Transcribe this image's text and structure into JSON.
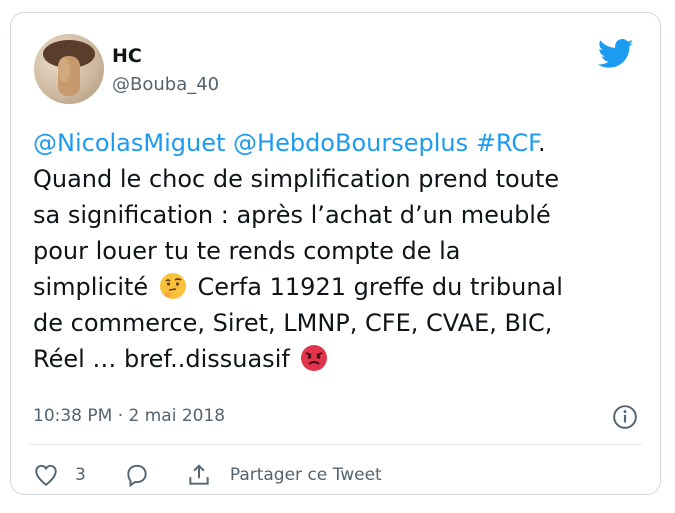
{
  "tweet": {
    "author_name": "HC",
    "author_handle": "@Bouba_40",
    "mentions": [
      "@NicolasMiguet",
      "@HebdoBourseplus",
      "#RCF"
    ],
    "text_after_mentions": ".",
    "line2": "Quand le choc de simplification prend toute",
    "line3": "sa signification : après l’achat d’un meublé",
    "line4": "pour louer tu te rends compte de la",
    "line5a": "simplicité",
    "line5b": "Cerfa 11921 greffe du tribunal",
    "line6": "de commerce, Siret, LMNP, CFE, CVAE, BIC,",
    "line7": "Réel … bref..dissuasif",
    "timestamp": "10:38 PM · 2 mai 2018",
    "like_count": "3",
    "share_label": "Partager ce Tweet"
  },
  "icons": {
    "brand": "twitter-bird-icon",
    "info": "info-icon",
    "like": "heart-icon",
    "reply": "reply-icon",
    "share": "share-icon",
    "emoji1": "thinking-face-emoji",
    "emoji2": "angry-face-emoji"
  },
  "colors": {
    "accent": "#1d9bf0",
    "text": "#0f1419",
    "muted": "#536471"
  }
}
